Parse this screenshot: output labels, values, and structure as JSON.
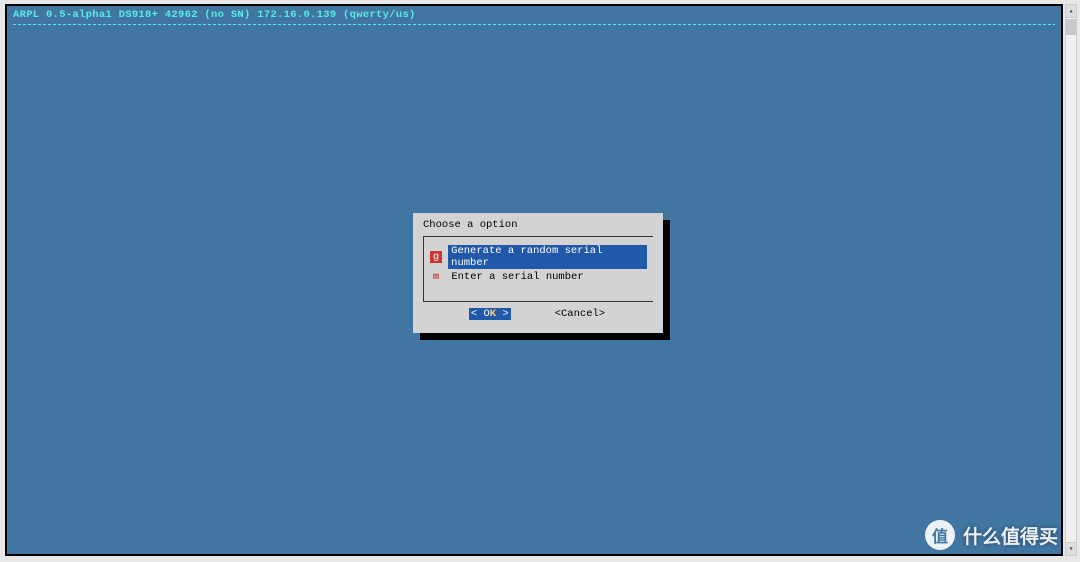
{
  "header": {
    "status_line": "ARPL 0.5-alpha1 DS918+ 42962 (no SN) 172.16.0.139 (qwerty/us)"
  },
  "dialog": {
    "title": "Choose a option",
    "options": [
      {
        "marker": "g",
        "label": "Generate a random serial number",
        "selected": true
      },
      {
        "marker": "m",
        "label": "Enter a serial number",
        "selected": false
      }
    ],
    "buttons": {
      "ok": {
        "left": "<",
        "text": " O",
        "hotkey": "K",
        "right": " >"
      },
      "cancel": {
        "text": "<Cancel>"
      }
    }
  },
  "watermark": {
    "badge": "值",
    "text": "什么值得买"
  }
}
